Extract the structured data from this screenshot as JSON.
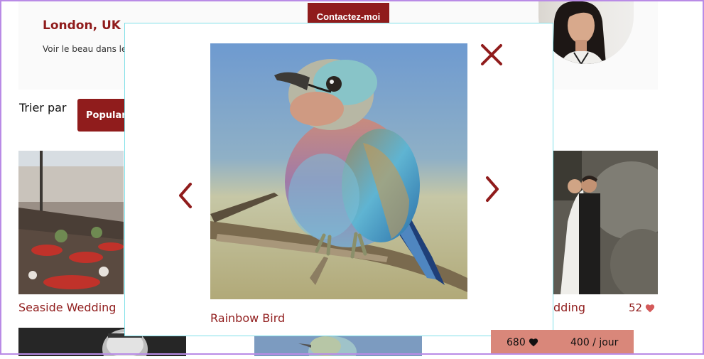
{
  "header": {
    "location": "London, UK",
    "tagline": "Voir le beau dans le",
    "contact_label": "Contactez-moi"
  },
  "sort": {
    "label": "Trier par",
    "selected": "Popularit"
  },
  "gallery": {
    "items": [
      {
        "title": "Seaside Wedding"
      },
      {
        "title": "dding",
        "likes": "52"
      }
    ]
  },
  "lightbox": {
    "caption": "Rainbow Bird",
    "close_icon": "close-icon",
    "prev_icon": "chevron-left-icon",
    "next_icon": "chevron-right-icon"
  },
  "stats": {
    "likes": "680",
    "price": "400 / jour"
  },
  "colors": {
    "brand": "#901c1c",
    "stats_bg": "#d9877a",
    "modal_border": "#7fe0e8"
  }
}
